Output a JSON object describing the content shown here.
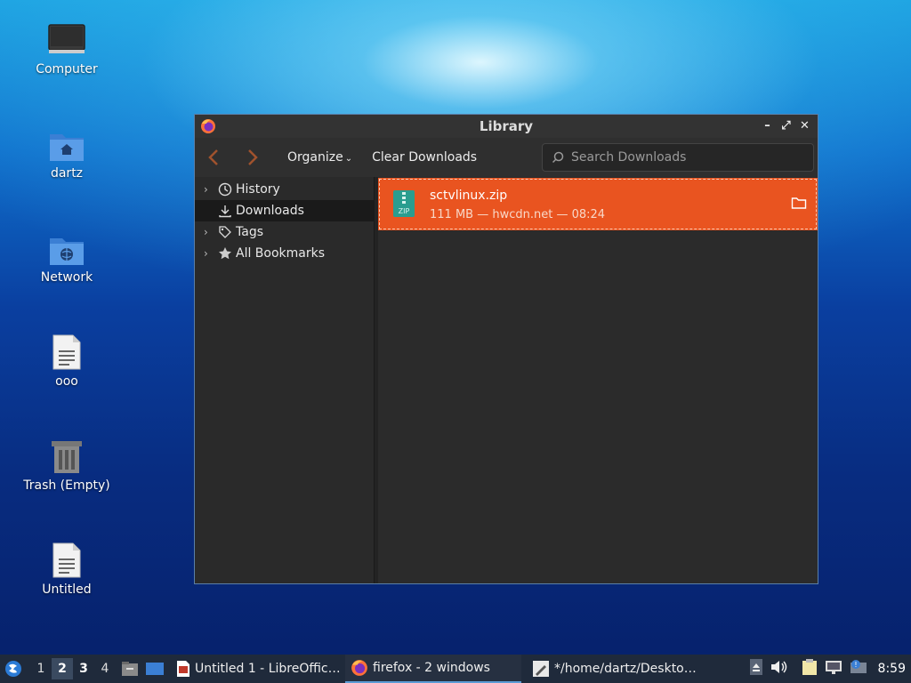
{
  "desktop": {
    "icons": [
      {
        "label": "Computer",
        "icon": "monitor-icon"
      },
      {
        "label": "dartz",
        "icon": "home-folder-icon"
      },
      {
        "label": "Network",
        "icon": "network-folder-icon"
      },
      {
        "label": "ooo",
        "icon": "text-file-icon"
      },
      {
        "label": "Trash (Empty)",
        "icon": "trash-icon"
      },
      {
        "label": "Untitled",
        "icon": "text-file-icon"
      }
    ]
  },
  "window": {
    "title": "Library",
    "toolbar": {
      "organize_label": "Organize",
      "clear_downloads_label": "Clear Downloads",
      "search_placeholder": "Search Downloads"
    },
    "sidebar": {
      "items": [
        {
          "label": "History",
          "icon": "clock-icon",
          "expandable": true
        },
        {
          "label": "Downloads",
          "icon": "download-icon",
          "expandable": false,
          "selected": true
        },
        {
          "label": "Tags",
          "icon": "tag-icon",
          "expandable": true
        },
        {
          "label": "All Bookmarks",
          "icon": "star-icon",
          "expandable": true
        }
      ]
    },
    "downloads": [
      {
        "name": "sctvlinux.zip",
        "meta": "111 MB — hwcdn.net — 08:24",
        "icon": "zip-file-icon"
      }
    ]
  },
  "taskbar": {
    "workspaces": [
      "1",
      "2",
      "3",
      "4"
    ],
    "tasks": [
      {
        "label": "Untitled 1 - LibreOffic…",
        "icon": "libreoffice-writer-icon"
      },
      {
        "label": "firefox - 2 windows",
        "icon": "firefox-icon",
        "active": true
      },
      {
        "label": "*/home/dartz/Deskto…",
        "icon": "text-editor-icon"
      }
    ],
    "clock": "8:59"
  },
  "colors": {
    "accent": "#e95420",
    "window_bg": "#2b2b2b",
    "taskbar_bg": "#1f2a3b"
  }
}
